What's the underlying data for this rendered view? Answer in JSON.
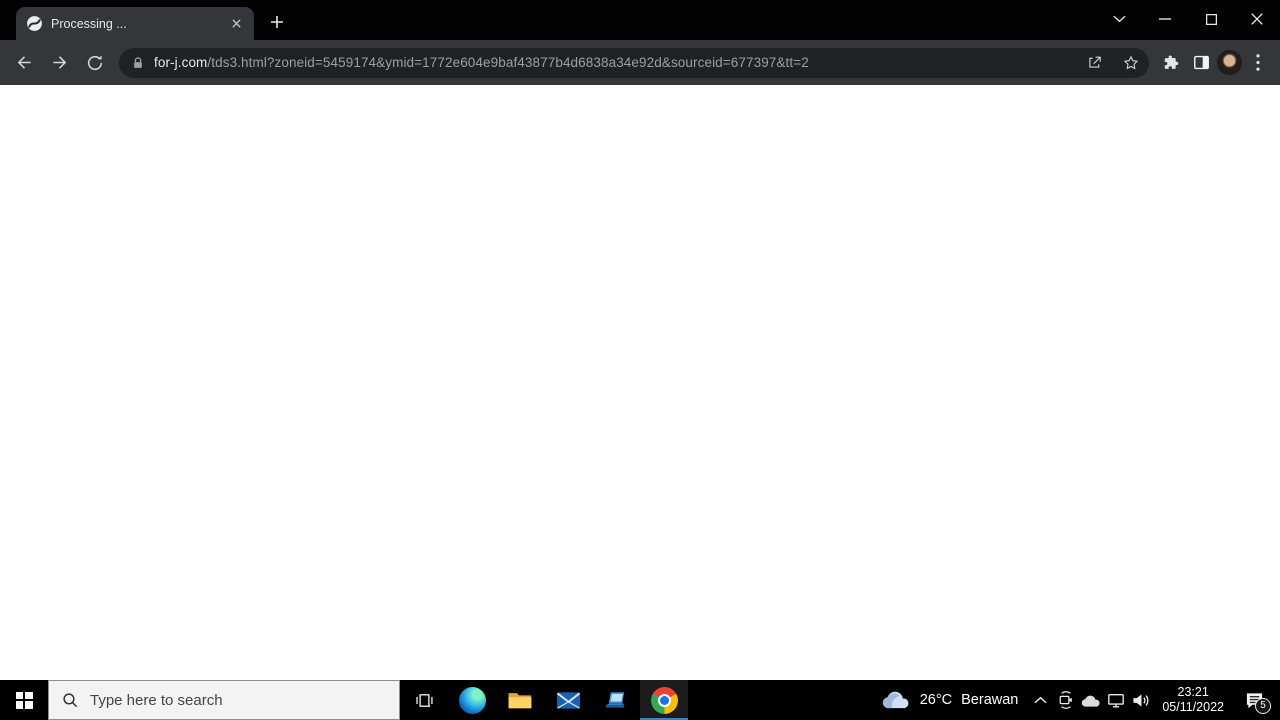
{
  "browser": {
    "tab_title": "Processing ...",
    "url_domain": "for-j.com",
    "url_path": "/tds3.html?zoneid=5459174&ymid=1772e604e9baf43877b4d6838a34e92d&sourceid=677397&tt=2"
  },
  "taskbar": {
    "search_placeholder": "Type here to search",
    "pinned_apps": [
      "task-view",
      "edge",
      "file-explorer",
      "mail",
      "pc",
      "chrome"
    ],
    "active_app": "chrome",
    "tray": {
      "temperature": "26°C",
      "condition": "Berawan",
      "time": "23:21",
      "date": "05/11/2022",
      "notification_count": "5"
    }
  },
  "icons": {
    "tab_favicon": "globe-swirl-circle",
    "tab_close": "x",
    "new_tab": "plus",
    "window_controls": [
      "chevron-down",
      "minimize",
      "maximize",
      "close"
    ],
    "nav": [
      "back-arrow",
      "forward-arrow",
      "reload"
    ],
    "omnibox": [
      "lock",
      "share",
      "star"
    ],
    "toolbar_right": [
      "extensions-puzzle",
      "side-panel",
      "profile-avatar",
      "kebab-menu"
    ],
    "tray": [
      "weather-cloud",
      "chevron-up",
      "screen-recorder",
      "onedrive-cloud",
      "network",
      "volume",
      "action-center-bubble"
    ]
  },
  "colors": {
    "titlebar": "#030303",
    "tab_toolbar": "#35363a",
    "omnibox": "#202124",
    "page": "#ffffff",
    "taskbar": "#010102",
    "search_box": "#f3f3f3",
    "active_app_underline": "#4580b0",
    "url_domain_text": "#e8eaed",
    "url_path_text": "#9aa0a6"
  }
}
